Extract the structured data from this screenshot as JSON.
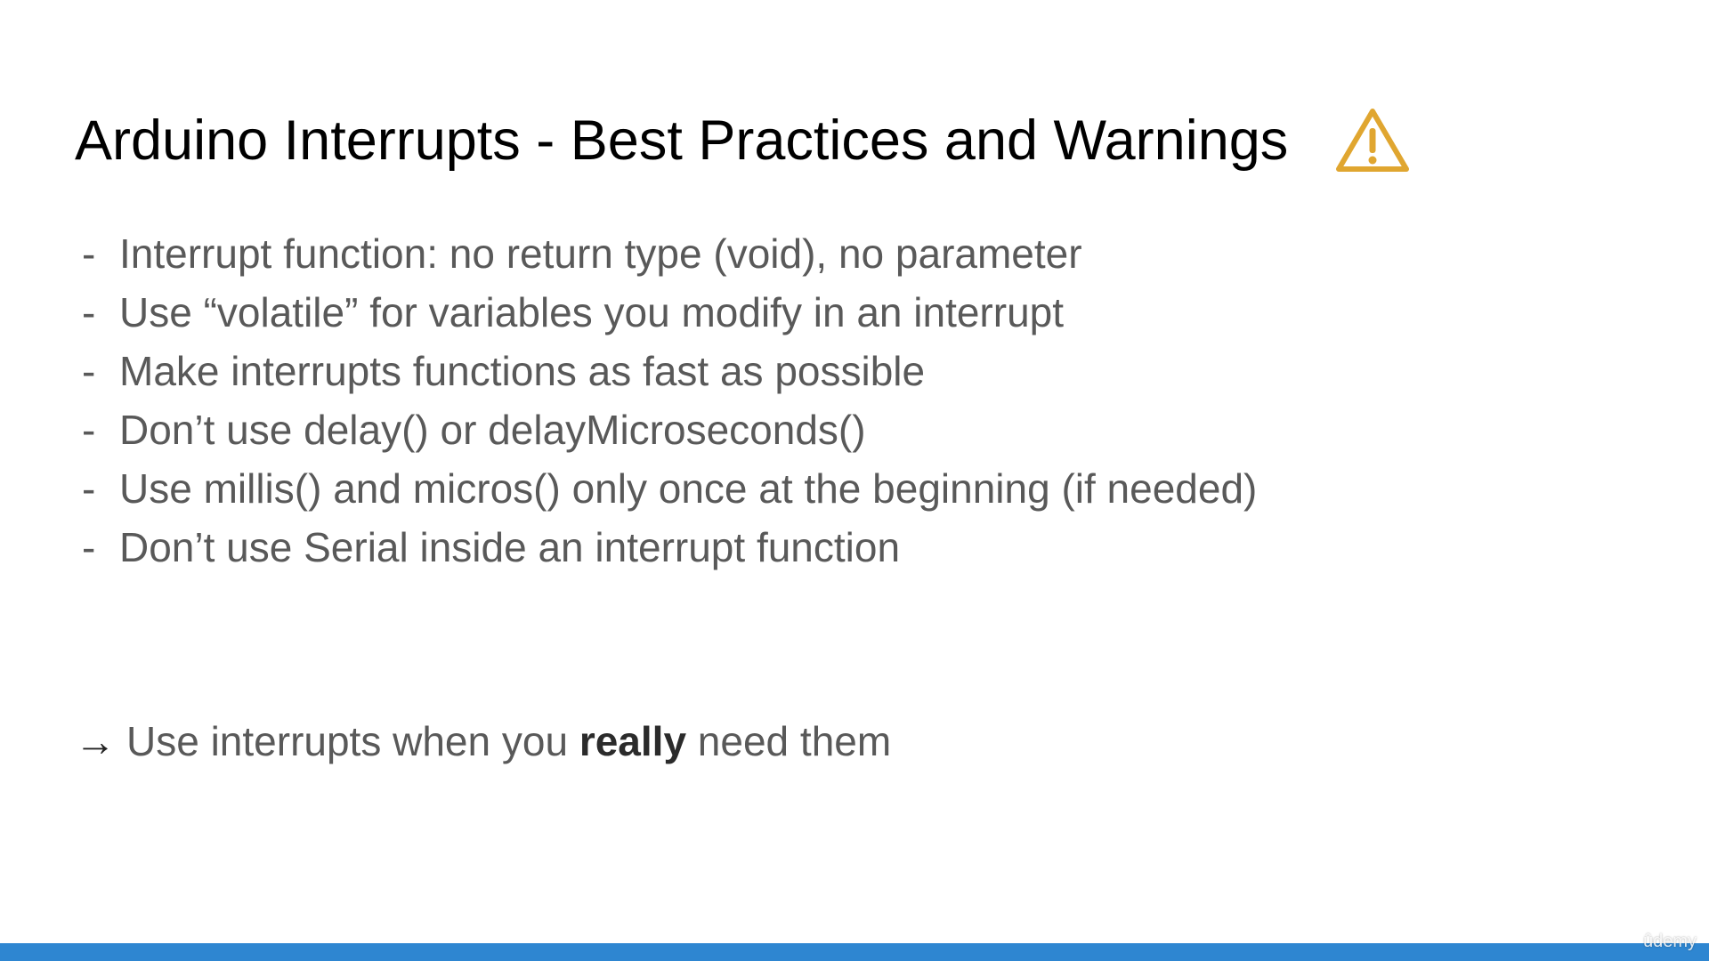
{
  "slide": {
    "title": "Arduino Interrupts - Best Practices and Warnings",
    "title_icon": "warning-triangle-icon",
    "accent_color": "#E0A630",
    "bullet_marker": "-",
    "bullets": [
      "Interrupt function: no return type (void), no parameter",
      "Use “volatile” for variables you modify in an interrupt",
      "Make interrupts functions as fast as possible",
      "Don’t use delay() or delayMicroseconds()",
      "Use millis() and micros() only once at the beginning (if needed)",
      "Don’t use Serial inside an interrupt function"
    ],
    "conclusion": {
      "arrow": "→",
      "prefix": "Use interrupts when you ",
      "emphasis": "really",
      "suffix": " need them"
    }
  },
  "footer": {
    "bar_color": "#2E86D1",
    "watermark": "ûdemy"
  }
}
